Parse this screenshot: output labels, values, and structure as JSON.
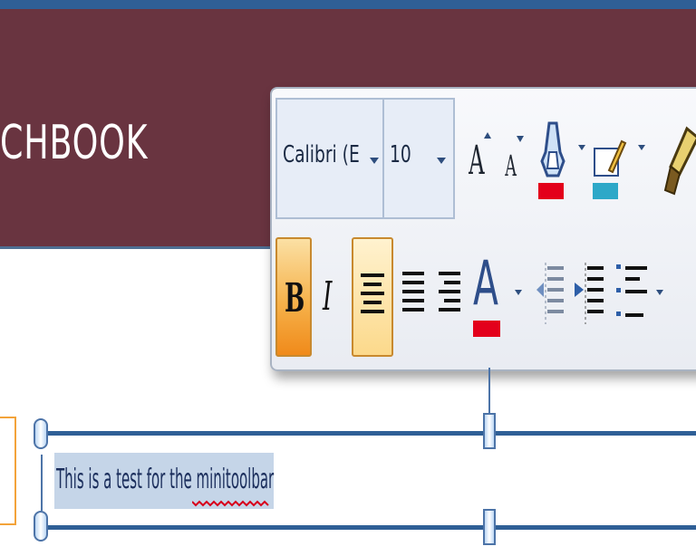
{
  "header": {
    "title": "CHBOOK"
  },
  "minitoolbar": {
    "font_name": "Calibri (E",
    "font_size": "10",
    "highlight_color": "#e3001b",
    "font_color_top": "#2ea8c8",
    "font_color": "#e3001b",
    "icons": [
      "grow-font-icon",
      "shrink-font-icon",
      "highlighter-icon",
      "font-color-icon",
      "format-painter-icon",
      "bold-icon",
      "italic-icon",
      "align-center-icon",
      "align-left-icon",
      "align-right-icon",
      "decrease-indent-icon",
      "increase-indent-icon",
      "bullets-icon"
    ]
  },
  "document": {
    "selected_text": "This is a test for the minitoolbar"
  },
  "colors": {
    "header_bg": "#693440",
    "accent_blue": "#2f5f96",
    "pressed_orange": "#f6b24b"
  }
}
